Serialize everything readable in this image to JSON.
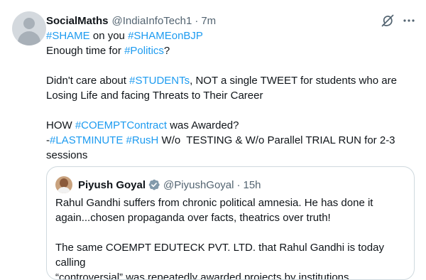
{
  "tweet": {
    "display_name": "SocialMaths",
    "handle": "@IndiaInfoTech1",
    "separator": "·",
    "time": "7m",
    "line1": [
      {
        "text": "#SHAME",
        "link": true
      },
      {
        "text": " on you ",
        "link": false
      },
      {
        "text": "#SHAMEonBJP",
        "link": true
      }
    ],
    "line2": [
      {
        "text": "Enough time for ",
        "link": false
      },
      {
        "text": "#Politics",
        "link": true
      },
      {
        "text": "?",
        "link": false
      }
    ],
    "line3": [
      {
        "text": "Didn't care about ",
        "link": false
      },
      {
        "text": "#STUDENTs",
        "link": true
      },
      {
        "text": ", NOT a single TWEET for students who are",
        "link": false
      }
    ],
    "line4": [
      {
        "text": "Losing Life and facing Threats to Their Career",
        "link": false
      }
    ],
    "line5": [
      {
        "text": "HOW ",
        "link": false
      },
      {
        "text": "#COEMPTContract",
        "link": true
      },
      {
        "text": " was Awarded?",
        "link": false
      }
    ],
    "line6": [
      {
        "text": "-",
        "link": false
      },
      {
        "text": "#LASTMINUTE",
        "link": true
      },
      {
        "text": " ",
        "link": false
      },
      {
        "text": "#RusH",
        "link": true
      },
      {
        "text": " W/o  TESTING & W/o Parallel TRIAL RUN for 2-3",
        "link": false
      }
    ],
    "line7": [
      {
        "text": "sessions",
        "link": false
      }
    ]
  },
  "quote": {
    "display_name": "Piyush Goyal",
    "handle": "@PiyushGoyal",
    "separator": "·",
    "time": "15h",
    "line1": "Rahul Gandhi suffers from chronic political amnesia. He has done it",
    "line2": "again...chosen propaganda over facts, theatrics over truth!",
    "line3": "The same COEMPT EDUTECK PVT. LTD. that Rahul Gandhi is today calling",
    "line4": "“controversial” was repeatedly awarded projects by institutions ..."
  },
  "icons": {
    "grok": "grok-icon",
    "more": "more-icon",
    "verified": "verified-badge-icon"
  },
  "colors": {
    "link": "#1d9bf0",
    "secondary_text": "#536471",
    "primary_text": "#0f1419",
    "verified_badge": "#829aab",
    "border": "#cfd9de"
  }
}
